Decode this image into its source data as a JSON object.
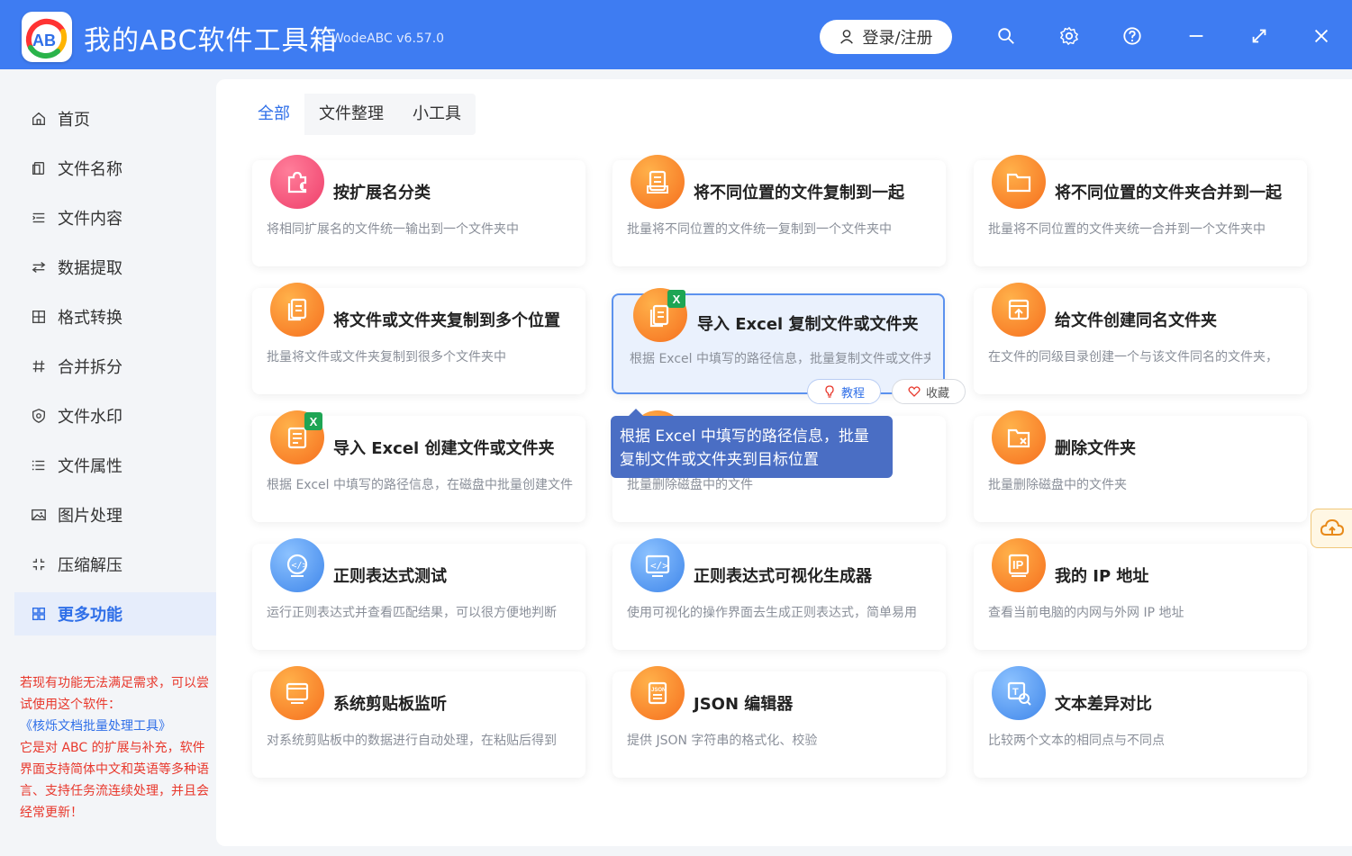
{
  "app": {
    "title": "我的ABC软件工具箱",
    "version": "WodeABC v6.57.0",
    "login_label": "登录/注册",
    "brand_color": "#3e7cf2"
  },
  "titlebar_icons": [
    "search-icon",
    "settings-icon",
    "help-icon",
    "minimize-icon",
    "maximize-icon",
    "close-icon"
  ],
  "sidebar": {
    "items": [
      {
        "label": "首页",
        "icon": "home-icon"
      },
      {
        "label": "文件名称",
        "icon": "file-name-icon"
      },
      {
        "label": "文件内容",
        "icon": "file-content-icon"
      },
      {
        "label": "数据提取",
        "icon": "data-extract-icon"
      },
      {
        "label": "格式转换",
        "icon": "format-convert-icon"
      },
      {
        "label": "合并拆分",
        "icon": "merge-split-icon"
      },
      {
        "label": "文件水印",
        "icon": "watermark-icon"
      },
      {
        "label": "文件属性",
        "icon": "file-attr-icon"
      },
      {
        "label": "图片处理",
        "icon": "image-icon"
      },
      {
        "label": "压缩解压",
        "icon": "compress-icon"
      },
      {
        "label": "更多功能",
        "icon": "more-icon",
        "active": true
      }
    ],
    "note": {
      "line1": "若现有功能无法满足需求，可以尝试使用这个软件：",
      "link": "《核烁文档批量处理工具》",
      "line2": "它是对 ABC 的扩展与补充，软件界面支持简体中文和英语等多种语言、支持任务流连续处理，并且会经常更新！"
    }
  },
  "tabs": [
    {
      "label": "全部",
      "active": true
    },
    {
      "label": "文件整理"
    },
    {
      "label": "小工具"
    }
  ],
  "cards": [
    {
      "title": "按扩展名分类",
      "desc": "将相同扩展名的文件统一输出到一个文件夹中",
      "icon": "puzzle-icon",
      "color": "pink"
    },
    {
      "title": "将不同位置的文件复制到一起",
      "desc": "批量将不同位置的文件统一复制到一个文件夹中",
      "icon": "copy-file-icon",
      "color": "orange"
    },
    {
      "title": "将不同位置的文件夹合并到一起",
      "desc": "批量将不同位置的文件夹统一合并到一个文件夹中",
      "icon": "folder-icon",
      "color": "orange"
    },
    {
      "title": "将文件或文件夹复制到多个位置",
      "desc": "批量将文件或文件夹复制到很多个文件夹中",
      "icon": "multi-copy-icon",
      "color": "orange"
    },
    {
      "title": "导入 Excel 复制文件或文件夹",
      "desc": "根据 Excel 中填写的路径信息，批量复制文件或文件夹到目标位置",
      "icon": "excel-copy-icon",
      "color": "orange",
      "highlight": true
    },
    {
      "title": "给文件创建同名文件夹",
      "desc": "在文件的同级目录创建一个与该文件同名的文件夹，",
      "icon": "create-folder-icon",
      "color": "orange"
    },
    {
      "title": "导入 Excel 创建文件或文件夹",
      "desc": "根据 Excel 中填写的路径信息，在磁盘中批量创建文件或文件夹",
      "icon": "excel-create-icon",
      "color": "orange"
    },
    {
      "title": "",
      "desc": "批量删除磁盘中的文件",
      "icon": "delete-file-icon",
      "color": "orange"
    },
    {
      "title": "删除文件夹",
      "desc": "批量删除磁盘中的文件夹",
      "icon": "delete-folder-icon",
      "color": "orange"
    },
    {
      "title": "正则表达式测试",
      "desc": "运行正则表达式并查看匹配结果，可以很方便地判断",
      "icon": "regex-test-icon",
      "color": "blue"
    },
    {
      "title": "正则表达式可视化生成器",
      "desc": "使用可视化的操作界面去生成正则表达式，简单易用",
      "icon": "regex-gen-icon",
      "color": "blue"
    },
    {
      "title": "我的 IP 地址",
      "desc": "查看当前电脑的内网与外网 IP 地址",
      "icon": "ip-icon",
      "color": "orange"
    },
    {
      "title": "系统剪贴板监听",
      "desc": "对系统剪贴板中的数据进行自动处理，在粘贴后得到",
      "icon": "clipboard-icon",
      "color": "orange"
    },
    {
      "title": "JSON 编辑器",
      "desc": "提供 JSON 字符串的格式化、校验",
      "icon": "json-icon",
      "color": "orange"
    },
    {
      "title": "文本差异对比",
      "desc": "比较两个文本的相同点与不同点",
      "icon": "text-diff-icon",
      "color": "blue"
    }
  ],
  "card_actions": {
    "tutorial": "教程",
    "favorite": "收藏"
  },
  "tooltip": "根据 Excel 中填写的路径信息，批量复制文件或文件夹到目标位置"
}
